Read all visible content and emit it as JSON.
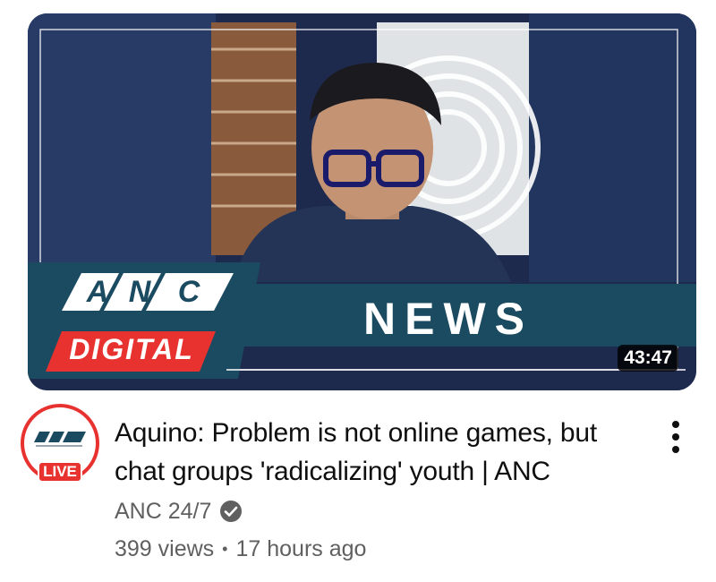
{
  "video": {
    "duration": "43:47",
    "title": "Aquino: Problem is not online games, but chat groups 'radicalizing' youth | ANC",
    "channel": "ANC 24/7",
    "views": "399 views",
    "separator": "•",
    "age": "17 hours ago"
  },
  "thumbnail_banner": {
    "logo_letters": [
      "A",
      "N",
      "C"
    ],
    "logo_sub": "DIGITAL",
    "news_label": "NEWS"
  },
  "avatar": {
    "live_label": "LIVE",
    "logo_text": "ANC"
  },
  "icons": {
    "verified": "check-circle-icon",
    "menu": "more-vert-icon"
  },
  "colors": {
    "brand_red": "#e8322f",
    "banner_teal": "#1b4b61",
    "text_primary": "#0f0f0f",
    "text_secondary": "#606060"
  }
}
